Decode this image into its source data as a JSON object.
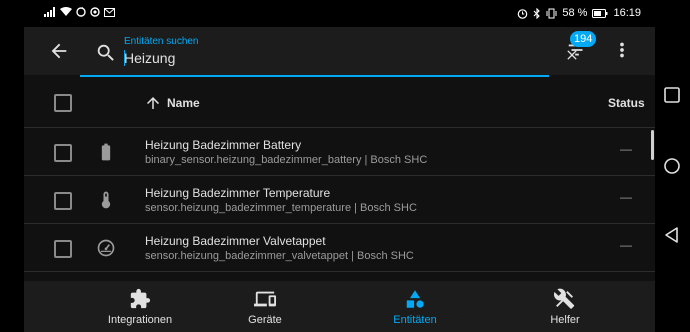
{
  "status_bar": {
    "icons_left": [
      "signal-icon",
      "wifi-icon",
      "sync-icon",
      "vpn-icon",
      "gmail-icon"
    ],
    "icons_right": [
      "alarm-icon",
      "bluetooth-icon",
      "vibrate-icon"
    ],
    "battery": "58 %",
    "time": "16:19"
  },
  "header": {
    "search_label": "Entitäten suchen",
    "search_value": "Heizung",
    "filter_count": "194",
    "accent": "#03a9f4"
  },
  "table": {
    "columns": {
      "name": "Name",
      "status": "Status"
    },
    "rows": [
      {
        "icon": "battery-icon",
        "title": "Heizung Badezimmer Battery",
        "subtitle": "binary_sensor.heizung_badezimmer_battery | Bosch SHC",
        "status": "—"
      },
      {
        "icon": "thermometer-icon",
        "title": "Heizung Badezimmer Temperature",
        "subtitle": "sensor.heizung_badezimmer_temperature | Bosch SHC",
        "status": "—"
      },
      {
        "icon": "gauge-icon",
        "title": "Heizung Badezimmer Valvetappet",
        "subtitle": "sensor.heizung_badezimmer_valvetappet | Bosch SHC",
        "status": "—"
      }
    ]
  },
  "bottom_nav": {
    "items": [
      {
        "icon": "puzzle-icon",
        "label": "Integrationen",
        "active": false
      },
      {
        "icon": "devices-icon",
        "label": "Geräte",
        "active": false
      },
      {
        "icon": "shapes-icon",
        "label": "Entitäten",
        "active": true
      },
      {
        "icon": "tools-icon",
        "label": "Helfer",
        "active": false
      }
    ]
  }
}
